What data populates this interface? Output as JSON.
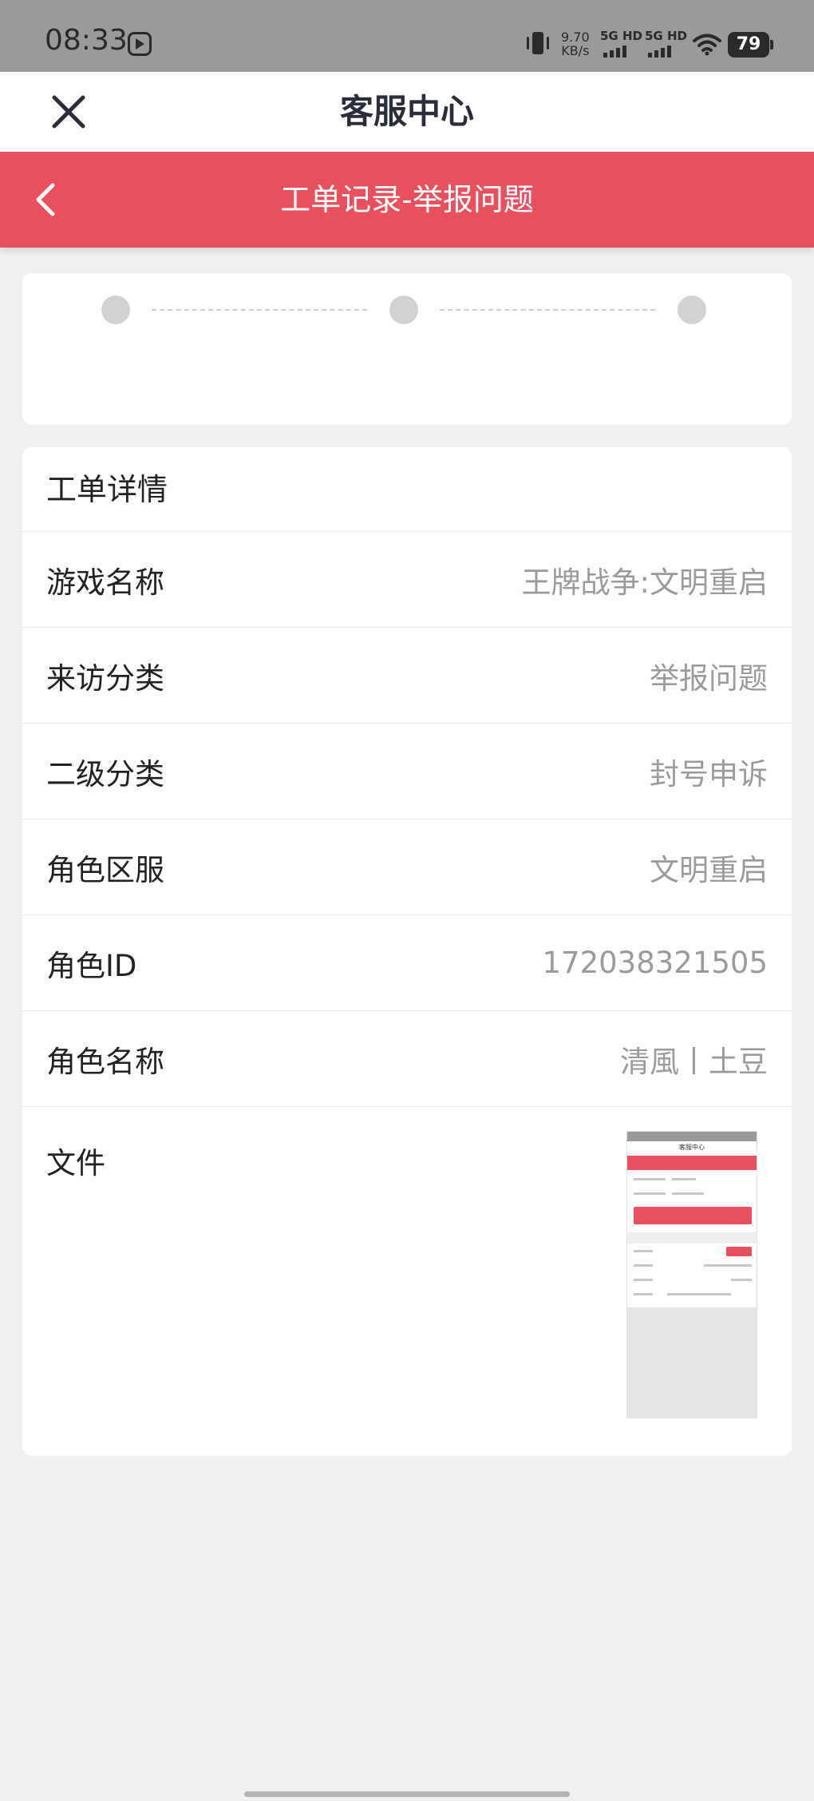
{
  "status_bar": {
    "time": "08:33",
    "speed_value": "9.70",
    "speed_unit": "KB/s",
    "sim1": "5G HD",
    "sim2": "5G HD",
    "battery": "79"
  },
  "app_bar": {
    "title": "客服中心"
  },
  "header": {
    "title": "工单记录-举报问题"
  },
  "progress": {
    "steps": 3,
    "dot_color": "#d2d2d2"
  },
  "detail": {
    "heading": "工单详情",
    "rows": [
      {
        "label": "游戏名称",
        "value": "王牌战争:文明重启"
      },
      {
        "label": "来访分类",
        "value": "举报问题"
      },
      {
        "label": "二级分类",
        "value": "封号申诉"
      },
      {
        "label": "角色区服",
        "value": "文明重启"
      },
      {
        "label": "角色ID",
        "value": "172038321505"
      },
      {
        "label": "角色名称",
        "value": "清風丨土豆"
      }
    ],
    "file_label": "文件",
    "thumbnail_title": "客服中心"
  },
  "colors": {
    "accent_red": "#e8505e",
    "background": "#f0f0f0",
    "status_bar": "#9a9a9a"
  },
  "icons": {
    "close": "close-icon",
    "back": "chevron-left-icon"
  }
}
